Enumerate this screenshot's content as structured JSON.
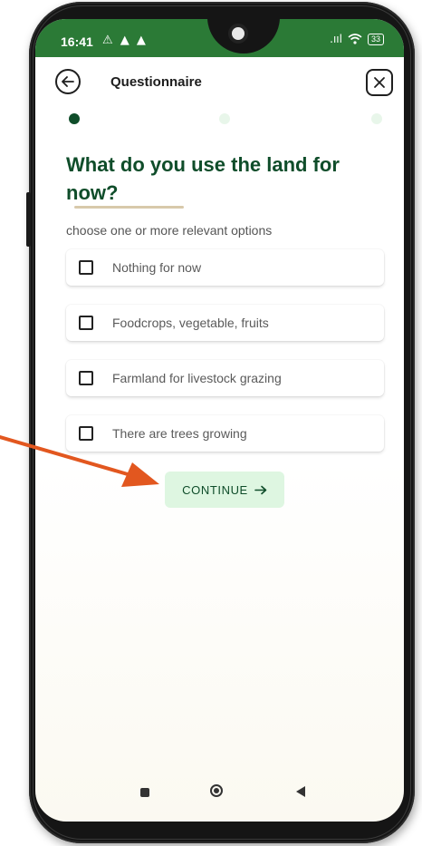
{
  "status_bar": {
    "time": "16:41",
    "left_icons": "⚠ ▲ ▲",
    "signal": ".ııl",
    "wifi": "wifi",
    "battery": "33"
  },
  "header": {
    "title": "Questionnaire"
  },
  "progress": {
    "steps": 3,
    "current": 1
  },
  "question": {
    "text": "What do you use the land for now?",
    "hint": "choose one or more relevant options"
  },
  "options": [
    {
      "label": "Nothing for now",
      "checked": false
    },
    {
      "label": "Foodcrops, vegetable, fruits",
      "checked": false
    },
    {
      "label": "Farmland for livestock grazing",
      "checked": false
    },
    {
      "label": "There are trees growing",
      "checked": false
    }
  ],
  "continue_button": {
    "label": "CONTINUE",
    "icon": "arrow-right-icon"
  },
  "colors": {
    "status_bar": "#2b7a36",
    "primary_dark": "#0f4d2a",
    "button_bg": "#def6e1",
    "accent_underline": "#d8c9ab",
    "annotation_arrow": "#e2571f"
  },
  "nav_bar": {
    "icons": [
      "recent-apps-icon",
      "home-icon",
      "back-icon"
    ]
  }
}
